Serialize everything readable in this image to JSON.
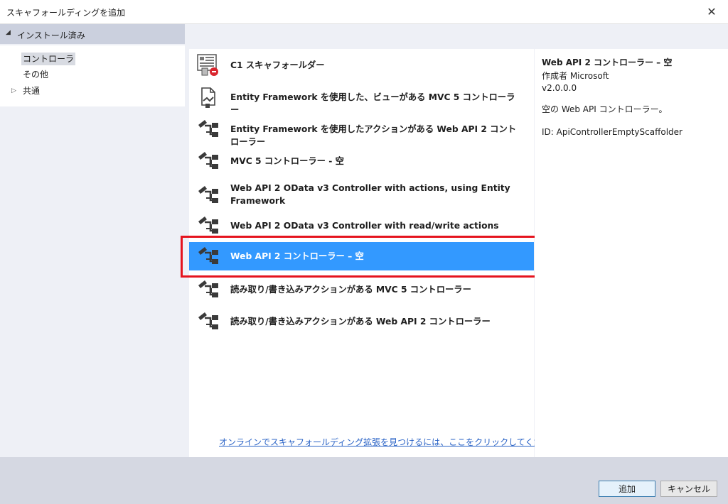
{
  "window": {
    "title": "スキャフォールディングを追加",
    "close_glyph": "✕"
  },
  "tree": {
    "header_arrow": "◢",
    "header_label": "インストール済み",
    "items": [
      {
        "label": "コントローラ",
        "selected": true
      },
      {
        "label": "その他",
        "selected": false
      },
      {
        "label": "共通",
        "selected": false,
        "expand": "▷"
      }
    ]
  },
  "scaffolders": [
    {
      "label": "C1 スキャフォールダー",
      "icon": "c1-scaffolder-icon"
    },
    {
      "label": "Entity Framework を使用した、ビューがある MVC 5 コントローラー",
      "icon": "mvc-view-icon"
    },
    {
      "label": "Entity Framework を使用したアクションがある Web API 2 コントローラー",
      "icon": "controller-icon"
    },
    {
      "label": "MVC 5 コントローラー - 空",
      "icon": "controller-icon"
    },
    {
      "label": "Web API 2 OData v3 Controller with actions, using Entity Framework",
      "icon": "controller-icon"
    },
    {
      "label": "Web API 2 OData v3 Controller with read/write actions",
      "icon": "controller-icon"
    },
    {
      "label": "Web API 2 コントローラー – 空",
      "icon": "controller-icon",
      "selected": true
    },
    {
      "label": "読み取り/書き込みアクションがある MVC 5 コントローラー",
      "icon": "controller-icon"
    },
    {
      "label": "読み取り/書き込みアクションがある Web API 2 コントローラー",
      "icon": "controller-icon"
    }
  ],
  "online_link": "オンラインでスキャフォールディング拡張を見つけるには、ここをクリックしてください。",
  "details": {
    "title": "Web API 2 コントローラー – 空",
    "author": "作成者 Microsoft",
    "version": "v2.0.0.0",
    "description": "空の Web API コントローラー。",
    "id": "ID: ApiControllerEmptyScaffolder"
  },
  "buttons": {
    "add": "追加",
    "cancel": "キャンセル"
  },
  "colors": {
    "selection": "#3399ff",
    "highlight_border": "#e5141e",
    "link": "#2a63c6"
  }
}
